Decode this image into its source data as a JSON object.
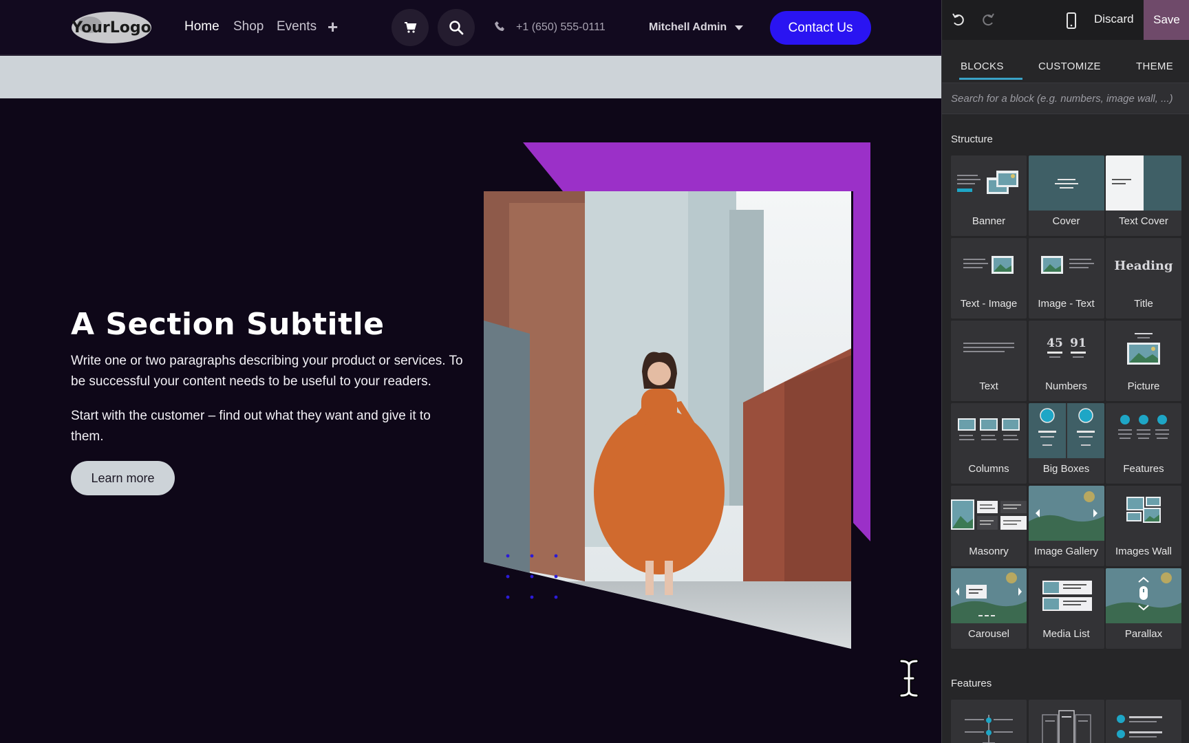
{
  "site": {
    "logo_text": "YourLogo",
    "nav": [
      "Home",
      "Shop",
      "Events"
    ],
    "phone": "+1 (650) 555-0111",
    "user": "Mitchell Admin",
    "contact_label": "Contact Us",
    "section": {
      "title": "A Section Subtitle",
      "para1": "Write one or two paragraphs describing your product or services. To be successful your content needs to be useful to your readers.",
      "para2": "Start with the customer – find out what they want and give it to them.",
      "button": "Learn more"
    },
    "colors": {
      "accent_button": "#2a14f2",
      "purple_shape": "#9b30c8",
      "background": "#0e0718"
    }
  },
  "editor": {
    "discard": "Discard",
    "save": "Save",
    "tabs": [
      "BLOCKS",
      "CUSTOMIZE",
      "THEME"
    ],
    "active_tab": "BLOCKS",
    "search_placeholder": "Search for a block (e.g. numbers, image wall, ...)",
    "categories": {
      "structure": "Structure",
      "features": "Features"
    },
    "blocks": [
      {
        "label": "Banner",
        "icon": "banner-icon"
      },
      {
        "label": "Cover",
        "icon": "cover-icon"
      },
      {
        "label": "Text Cover",
        "icon": "text-cover-icon"
      },
      {
        "label": "Text - Image",
        "icon": "text-image-icon"
      },
      {
        "label": "Image - Text",
        "icon": "image-text-icon"
      },
      {
        "label": "Title",
        "icon": "title-icon",
        "thumb_text": "Heading"
      },
      {
        "label": "Text",
        "icon": "text-icon"
      },
      {
        "label": "Numbers",
        "icon": "numbers-icon",
        "thumb_values": [
          "45",
          "91"
        ]
      },
      {
        "label": "Picture",
        "icon": "picture-icon"
      },
      {
        "label": "Columns",
        "icon": "columns-icon"
      },
      {
        "label": "Big Boxes",
        "icon": "big-boxes-icon"
      },
      {
        "label": "Features",
        "icon": "features-icon"
      },
      {
        "label": "Masonry",
        "icon": "masonry-icon"
      },
      {
        "label": "Image Gallery",
        "icon": "image-gallery-icon"
      },
      {
        "label": "Images Wall",
        "icon": "images-wall-icon"
      },
      {
        "label": "Carousel",
        "icon": "carousel-icon"
      },
      {
        "label": "Media List",
        "icon": "media-list-icon"
      },
      {
        "label": "Parallax",
        "icon": "parallax-icon"
      }
    ]
  }
}
